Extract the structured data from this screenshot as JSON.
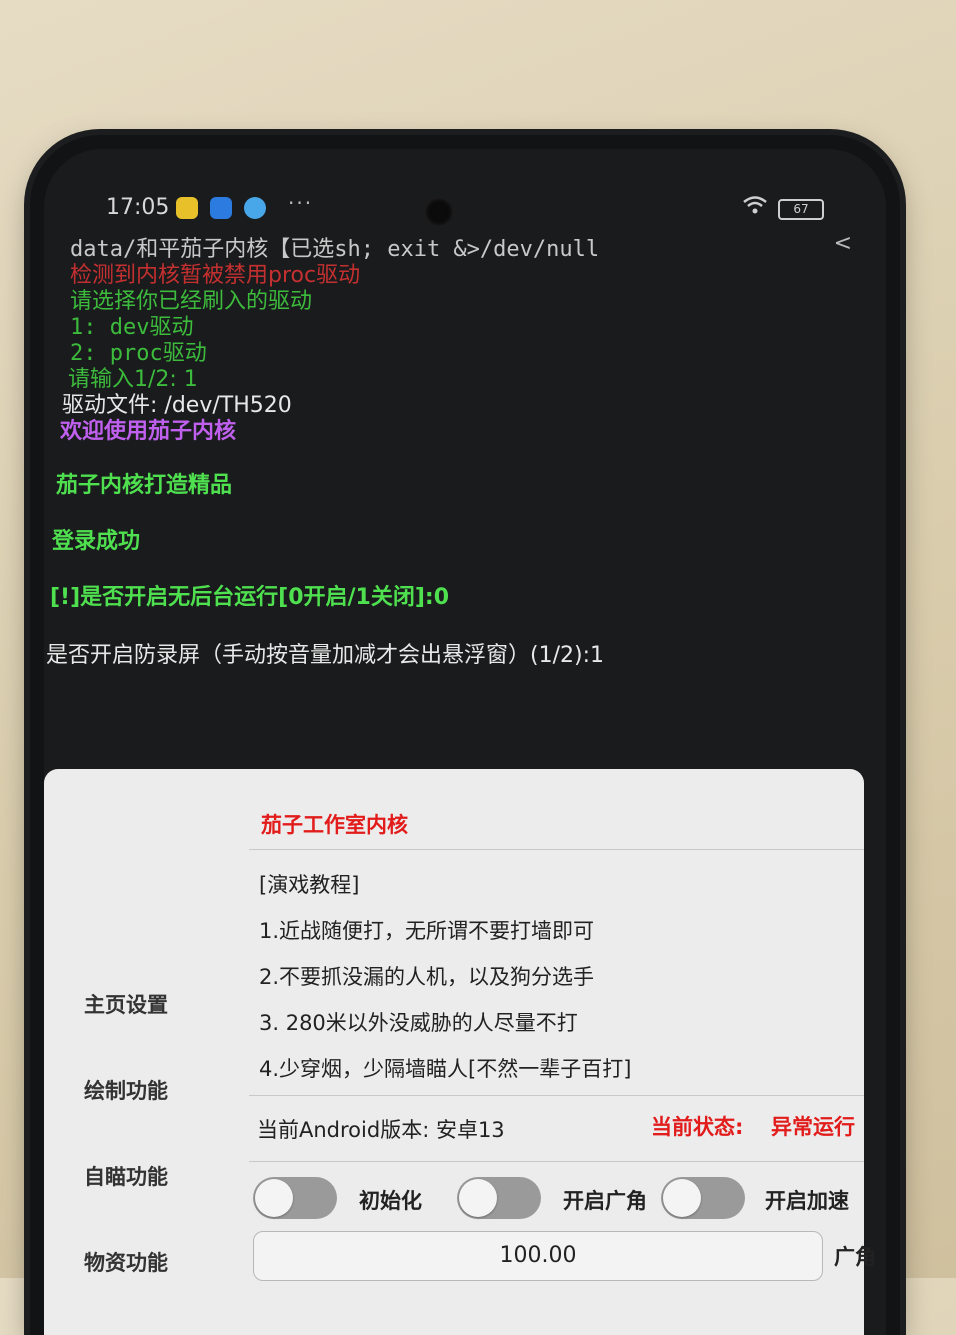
{
  "status_bar": {
    "time": "17:05",
    "dots": "···",
    "battery": "67"
  },
  "terminal": {
    "command": "data/和平茄子内核【已选sh; exit &>/dev/null",
    "back": "<",
    "line_error": "检测到内核暂被禁用proc驱动",
    "line_choose": "请选择你已经刷入的驱动",
    "option_dev": "1: dev驱动",
    "option_proc": "2: proc驱动",
    "input_prompt": "请输入1/2: 1",
    "driver_file": "驱动文件: /dev/TH520",
    "welcome": "欢迎使用茄子内核",
    "slogan": "茄子内核打造精品",
    "login_success": "登录成功",
    "background_prompt": "[!]是否开启无后台运行[0开启/1关闭]:0",
    "anti_record_prompt": "是否开启防录屏（手动按音量加减才会出悬浮窗）(1/2):1"
  },
  "panel": {
    "title": "茄子工作室内核",
    "sidebar": [
      "主页设置",
      "绘制功能",
      "自瞄功能",
      "物资功能"
    ],
    "tutorial_heading": "[演戏教程]",
    "tutorial_lines": [
      "1.近战随便打，无所谓不要打墙即可",
      "2.不要抓没漏的人机，以及狗分选手",
      "3. 280米以外没威胁的人尽量不打",
      "4.少穿烟，少隔墙瞄人[不然一辈子百打]"
    ],
    "version_text": "当前Android版本: 安卓13",
    "state_label": "当前状态:",
    "state_value": "异常运行",
    "toggles": [
      "初始化",
      "开启广角",
      "开启加速"
    ],
    "fov_value": "100.00",
    "fov_label": "广角"
  },
  "colors": {
    "terminal_green": "#3cbb3c",
    "terminal_purple": "#c060ee",
    "alert_red": "#e21b1b",
    "toggle_off": "#9a9a9a"
  }
}
